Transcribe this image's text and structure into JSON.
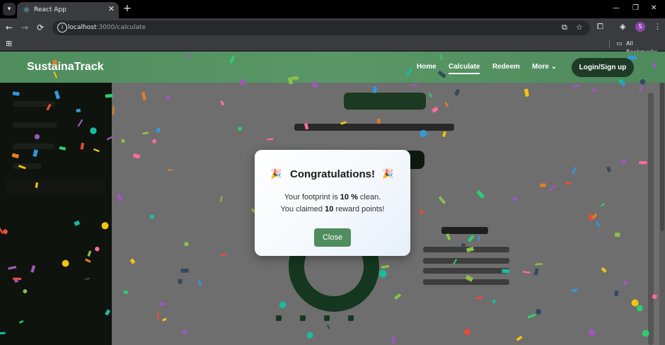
{
  "browser": {
    "tab_title": "React App",
    "url_host": "localhost",
    "url_path": ":3000/calculate",
    "bookmarks_label": "All Bookmarks",
    "profile_initial": "S"
  },
  "navbar": {
    "brand": "SustainaTrack",
    "links": [
      "Home",
      "Calculate",
      "Redeem",
      "More"
    ],
    "more_caret": "⌄",
    "login_label": "Login/Sign up"
  },
  "modal": {
    "title": "Congratulations!",
    "emoji": "🎉",
    "line1_prefix": "Your footprint is ",
    "line1_value": "10 %",
    "line1_suffix": " clean.",
    "line2_prefix": "You claimed ",
    "line2_value": "10",
    "line2_suffix": " reward points!",
    "close_label": "Close"
  },
  "colors": {
    "brand_green": "#4f8d5e",
    "dark_green": "#1f3b27",
    "confetti": [
      "#e74c3c",
      "#f1c40f",
      "#2ecc71",
      "#3498db",
      "#9b59b6",
      "#e67e22",
      "#1abc9c",
      "#ff6b9a",
      "#34495e",
      "#8bc34a"
    ]
  }
}
